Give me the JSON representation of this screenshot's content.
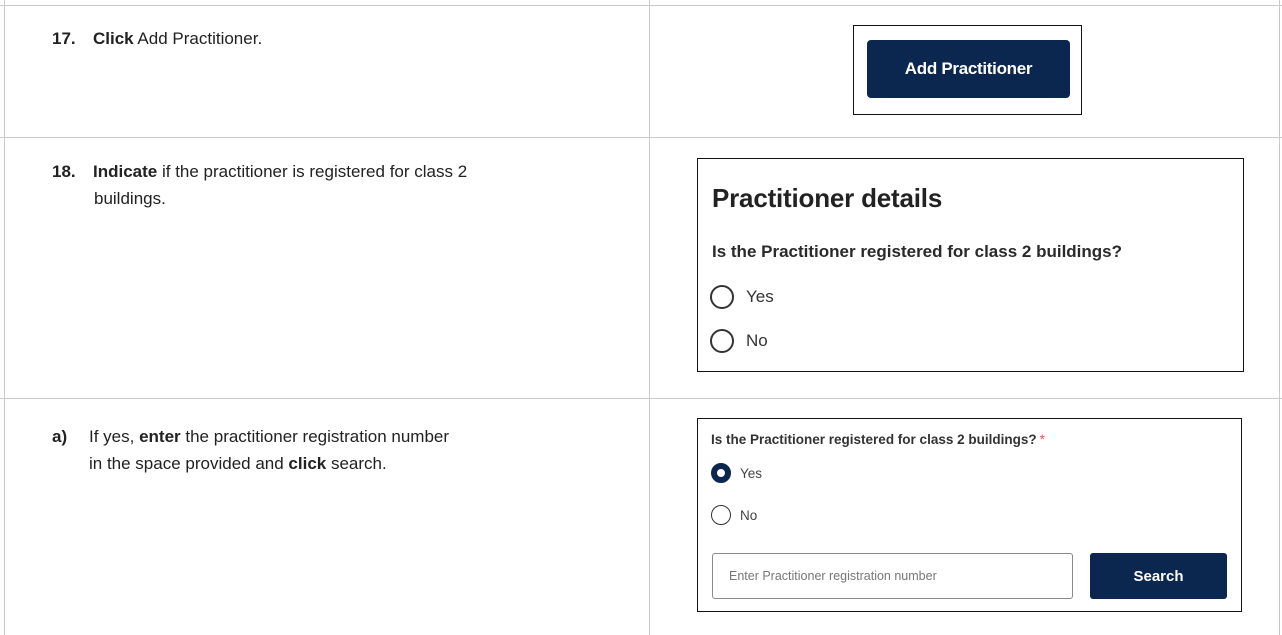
{
  "steps": [
    {
      "number": "17.",
      "verb": "Click",
      "rest": " Add Practitioner."
    },
    {
      "number": "18.",
      "verb": "Indicate",
      "rest_line1": " if the practitioner is registered for class 2",
      "rest_line2": "buildings."
    },
    {
      "number": "a)",
      "line1_pre": "If yes, ",
      "line1_verb": "enter",
      "line1_post": " the practitioner registration number",
      "line2_pre": "in the space provided and ",
      "line2_verb": "click",
      "line2_post": " search."
    }
  ],
  "screenshot1": {
    "button_label": "Add Practitioner"
  },
  "screenshot2": {
    "heading": "Practitioner details",
    "question": "Is the Practitioner registered for class 2 buildings?",
    "options": [
      "Yes",
      "No"
    ]
  },
  "screenshot3": {
    "question": "Is the Practitioner registered for class 2 buildings?",
    "required_marker": "*",
    "options": [
      {
        "label": "Yes",
        "selected": true
      },
      {
        "label": "No",
        "selected": false
      }
    ],
    "input_placeholder": "Enter Practitioner registration number",
    "search_label": "Search"
  },
  "colors": {
    "button_bg": "#0b2750",
    "required_star": "#d9534f",
    "border": "#c9c9c9"
  }
}
